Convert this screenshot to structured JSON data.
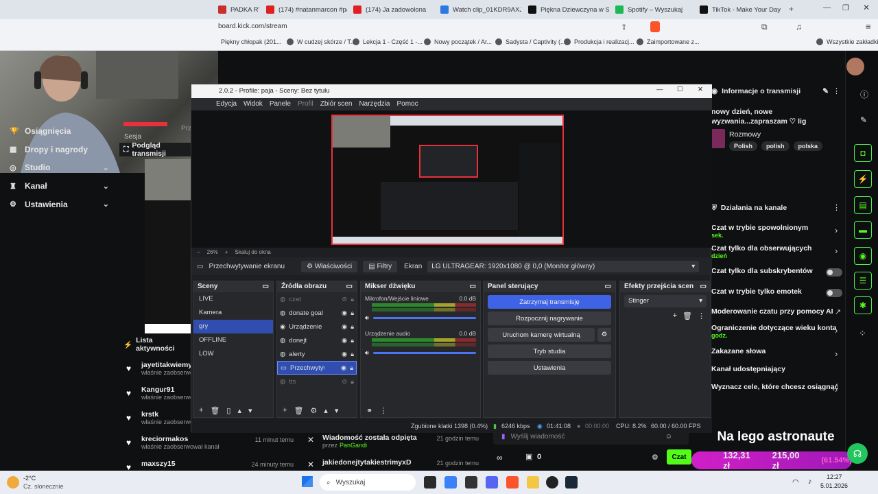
{
  "browser": {
    "tabs": [
      {
        "label": "PADKA RYBSCI",
        "color": "#c9302c"
      },
      {
        "label": "(174) #natanmarcon #paje",
        "color": "#e02020"
      },
      {
        "label": "(174) Ja zadowolona",
        "color": "#e02020"
      },
      {
        "label": "Watch clip_01KDR9AXJRY",
        "color": "#2a7ae2"
      },
      {
        "label": "Piękna Dziewczyna w Styl",
        "color": "#111111"
      },
      {
        "label": "Spotify – Wyszukaj",
        "color": "#1db954"
      },
      {
        "label": "TikTok - Make Your Day",
        "color": "#111111"
      }
    ],
    "url": "board.kick.com/stream",
    "bookmarks": [
      "Piękny chłopak (201...",
      "W cudzej skórze / T...",
      "Lekcja 1 - Część 1 -...",
      "Nowy początek / Ar...",
      "Sadysta / Captivity (...",
      "Produkcja i realizacj...",
      "Zaimportowane z...",
      "Wszystkie zakładki"
    ]
  },
  "kick": {
    "nav": [
      {
        "label": "Osiągnięcia",
        "icon": "trophy-icon",
        "chevron": false
      },
      {
        "label": "Dropy i nagrody",
        "icon": "gift-icon",
        "chevron": false
      },
      {
        "label": "Studio",
        "icon": "studio-icon",
        "chevron": true
      },
      {
        "label": "Kanał",
        "icon": "channel-icon",
        "chevron": true
      },
      {
        "label": "Ustawienia",
        "icon": "gear-icon",
        "chevron": true
      }
    ],
    "session_label": "Sesja",
    "session_label2": "Prz",
    "preview_title": "Podgląd transmisji",
    "activity_title": "Lista aktywności",
    "activity": [
      {
        "name": "jayetitakwiemy",
        "sub": "właśnie zaobserwo",
        "time": ""
      },
      {
        "name": "Kangur91",
        "sub": "właśnie zaobserwo",
        "time": ""
      },
      {
        "name": "krstk",
        "sub": "właśnie zaobserwo",
        "time": ""
      },
      {
        "name": "kreciormakos",
        "sub": "właśnie zaobserwował kanał",
        "time": "11 minut temu"
      },
      {
        "name": "maxszy15",
        "sub": "",
        "time": "24 minuty temu"
      }
    ],
    "pinned": [
      {
        "title": "Wiadomość została odpięta",
        "by_prefix": "przez",
        "by": "PanGandi",
        "time": "21 godzin temu"
      },
      {
        "title": "jakiedonejtytakiestrimyxD",
        "by_prefix": "",
        "by": "",
        "time": "21 godzin temu"
      }
    ],
    "info_title": "Informacje o transmisji",
    "stream_title": "nowy dzień, nowe wyzwania...zapraszam ♡ lig",
    "category": "Rozmowy",
    "tags": [
      "Polish",
      "polish",
      "polska"
    ],
    "actions_title": "Działania na kanale",
    "actions": [
      {
        "label": "Czat w trybie spowolnionym",
        "sub": "sek.",
        "kind": "arrow"
      },
      {
        "label": "Czat tylko dla obserwujących",
        "sub": "dzień",
        "kind": "arrow"
      },
      {
        "label": "Czat tylko dla subskrybentów",
        "sub": "",
        "kind": "toggle"
      },
      {
        "label": "Czat w trybie tylko emotek",
        "sub": "",
        "kind": "toggle"
      },
      {
        "label": "Moderowanie czatu przy pomocy AI",
        "sub": "",
        "kind": "ext"
      },
      {
        "label": "Ograniczenie dotyczące wieku konta",
        "sub": "godz.",
        "kind": "arrow"
      },
      {
        "label": "Zakazane słowa",
        "sub": "",
        "kind": "arrow"
      },
      {
        "label": "Kanał udostępniający",
        "sub": "",
        "kind": "none"
      },
      {
        "label": "Wyznacz cele, które chcesz osiągnąć",
        "sub": "",
        "kind": "arrow"
      }
    ],
    "chat_placeholder": "Wyślij wiadomość",
    "chat_send": "Czat",
    "chat_count": "0",
    "overlay_text": "Na lego astronaute",
    "goal_a": "132,31 zł",
    "goal_b": "215,00 zł",
    "goal_c": "(61.54%)"
  },
  "obs": {
    "title": "2.0.2 - Profile: paja - Sceny: Bez tytułu",
    "menu": [
      "Edycja",
      "Widok",
      "Panele",
      "Profil",
      "Zbiór scen",
      "Narzędzia",
      "Pomoc"
    ],
    "zoom": "26%",
    "zoom_label": "Skaluj do okna",
    "source_name": "Przechwytywanie ekranu",
    "props": "Właściwości",
    "filters": "Filtry",
    "screen_label": "Ekran",
    "screen_value": "LG ULTRAGEAR: 1920x1080 @ 0,0 (Monitor główny)",
    "scenes_title": "Sceny",
    "scenes": [
      {
        "label": "LIVE",
        "sel": false
      },
      {
        "label": "Kamera",
        "sel": false
      },
      {
        "label": "gry",
        "sel": true
      },
      {
        "label": "OFFLINE",
        "sel": false
      },
      {
        "label": "LOW",
        "sel": false
      }
    ],
    "sources_title": "Źródła obrazu",
    "sources": [
      {
        "label": "czat",
        "dim": true,
        "sel": false
      },
      {
        "label": "donate goal",
        "dim": false,
        "sel": false
      },
      {
        "label": "Urządzenie d",
        "dim": false,
        "sel": false
      },
      {
        "label": "donejt",
        "dim": false,
        "sel": false
      },
      {
        "label": "alerty",
        "dim": false,
        "sel": false
      },
      {
        "label": "Przechwytyw",
        "dim": false,
        "sel": true
      },
      {
        "label": "tts",
        "dim": true,
        "sel": false
      }
    ],
    "mixer_title": "Mikser dźwięku",
    "mixer": [
      {
        "label": "Mikrofon/Wejście liniowe",
        "db": "0.0 dB"
      },
      {
        "label": "Urządzenie audio",
        "db": "0.0 dB"
      }
    ],
    "control_title": "Panel sterujący",
    "controls": [
      "Zatrzymaj transmisję",
      "Rozpocznij nagrywanie",
      "Uruchom kamerę wirtualną",
      "Tryb studia",
      "Ustawienia"
    ],
    "transitions_title": "Efekty przejścia scen",
    "transition": "Stinger",
    "status": {
      "dropped": "Zgubione klatki 1398 (0.4%)",
      "kbps": "6246 kbps",
      "live_time": "01:41:08",
      "rec_time": "00:00:00",
      "cpu": "CPU: 8.2%",
      "fps": "60.00 / 60.00 FPS"
    }
  },
  "taskbar": {
    "weather_temp": "-2°C",
    "weather_desc": "Cz. słonecznie",
    "search": "Wyszukaj",
    "time": "12:27",
    "date": "5.01.2026"
  }
}
